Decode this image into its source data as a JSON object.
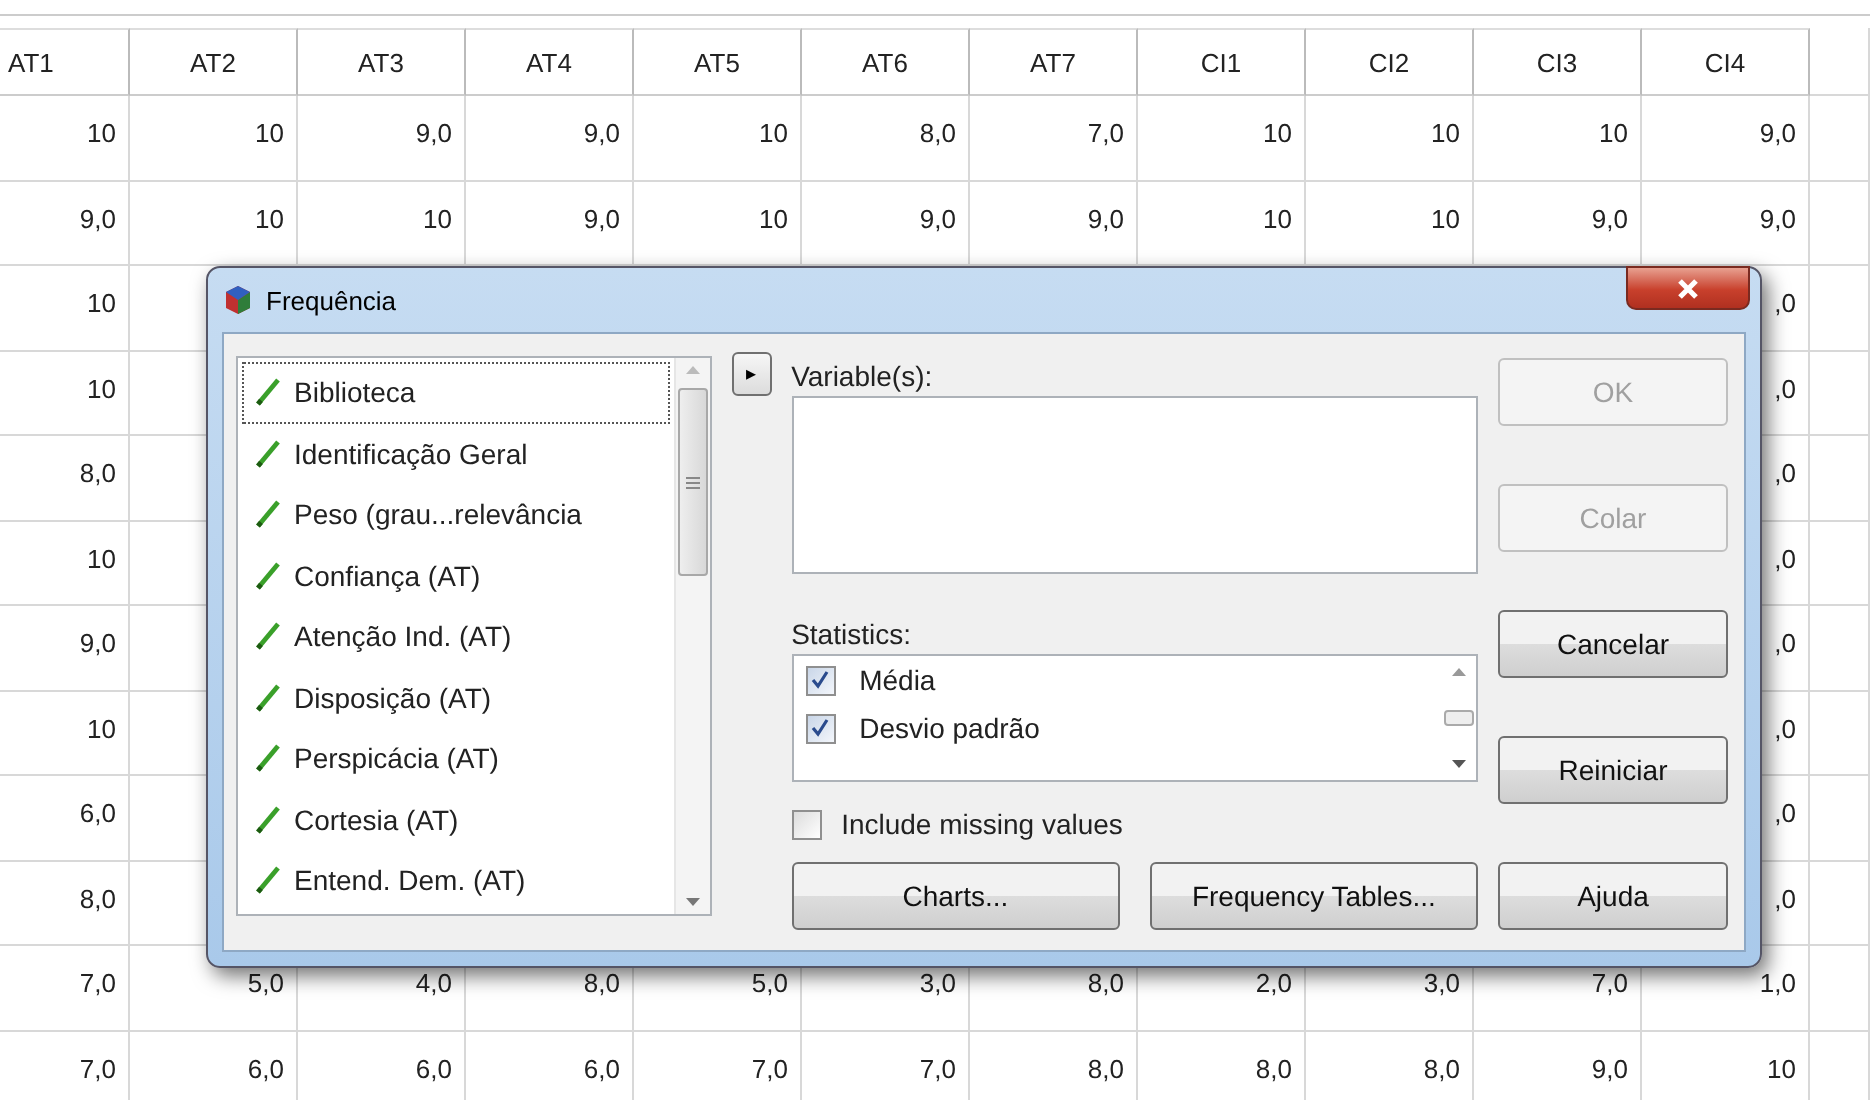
{
  "table": {
    "columns": [
      "AT1",
      "AT2",
      "AT3",
      "AT4",
      "AT5",
      "AT6",
      "AT7",
      "CI1",
      "CI2",
      "CI3",
      "CI4"
    ],
    "rows": [
      {
        "kind": "full",
        "cells": [
          "10",
          "10",
          "9,0",
          "9,0",
          "10",
          "8,0",
          "7,0",
          "10",
          "10",
          "10",
          "9,0"
        ]
      },
      {
        "kind": "full",
        "cells": [
          "9,0",
          "10",
          "10",
          "9,0",
          "10",
          "9,0",
          "9,0",
          "10",
          "10",
          "9,0",
          "9,0"
        ]
      },
      {
        "kind": "partial",
        "cells": [
          "10",
          ",0"
        ]
      },
      {
        "kind": "partial",
        "cells": [
          "10",
          ",0"
        ]
      },
      {
        "kind": "partial",
        "cells": [
          "8,0",
          ",0"
        ]
      },
      {
        "kind": "partial",
        "cells": [
          "10",
          ",0"
        ]
      },
      {
        "kind": "partial",
        "cells": [
          "9,0",
          ",0"
        ]
      },
      {
        "kind": "partial",
        "cells": [
          "10",
          ",0"
        ]
      },
      {
        "kind": "partial",
        "cells": [
          "6,0",
          ",0"
        ]
      },
      {
        "kind": "partial",
        "cells": [
          "8,0",
          ",0"
        ]
      },
      {
        "kind": "full",
        "cells": [
          "7,0",
          "5,0",
          "4,0",
          "8,0",
          "5,0",
          "3,0",
          "8,0",
          "2,0",
          "3,0",
          "7,0",
          "1,0"
        ]
      },
      {
        "kind": "full",
        "cells": [
          "7,0",
          "6,0",
          "6,0",
          "6,0",
          "7,0",
          "7,0",
          "8,0",
          "8,0",
          "8,0",
          "9,0",
          "10"
        ]
      }
    ]
  },
  "dialog": {
    "title": "Frequência",
    "variables": [
      {
        "label": "Biblioteca",
        "focused": true
      },
      {
        "label": "Identificação Geral",
        "focused": false
      },
      {
        "label": "Peso (grau...relevância",
        "focused": false
      },
      {
        "label": "Confiança (AT)",
        "focused": false
      },
      {
        "label": "Atenção Ind. (AT)",
        "focused": false
      },
      {
        "label": "Disposição (AT)",
        "focused": false
      },
      {
        "label": "Perspicácia (AT)",
        "focused": false
      },
      {
        "label": "Cortesia (AT)",
        "focused": false
      },
      {
        "label": "Entend. Dem. (AT)",
        "focused": false
      }
    ],
    "move_button": "▸",
    "variables_label": "Variable(s):",
    "statistics_label": "Statistics:",
    "statistics": [
      {
        "label": "Média",
        "checked": true
      },
      {
        "label": "Desvio padrão",
        "checked": true
      }
    ],
    "include_missing": {
      "label": "Include missing values",
      "checked": false
    },
    "bottom_buttons": [
      {
        "label": "Charts...",
        "disabled": false
      },
      {
        "label": "Frequency Tables...",
        "disabled": false
      }
    ],
    "side_buttons": [
      {
        "label": "OK",
        "disabled": true
      },
      {
        "label": "Colar",
        "disabled": true
      },
      {
        "label": "Cancelar",
        "disabled": false
      },
      {
        "label": "Reiniciar",
        "disabled": false
      },
      {
        "label": "Ajuda",
        "disabled": false
      }
    ]
  }
}
